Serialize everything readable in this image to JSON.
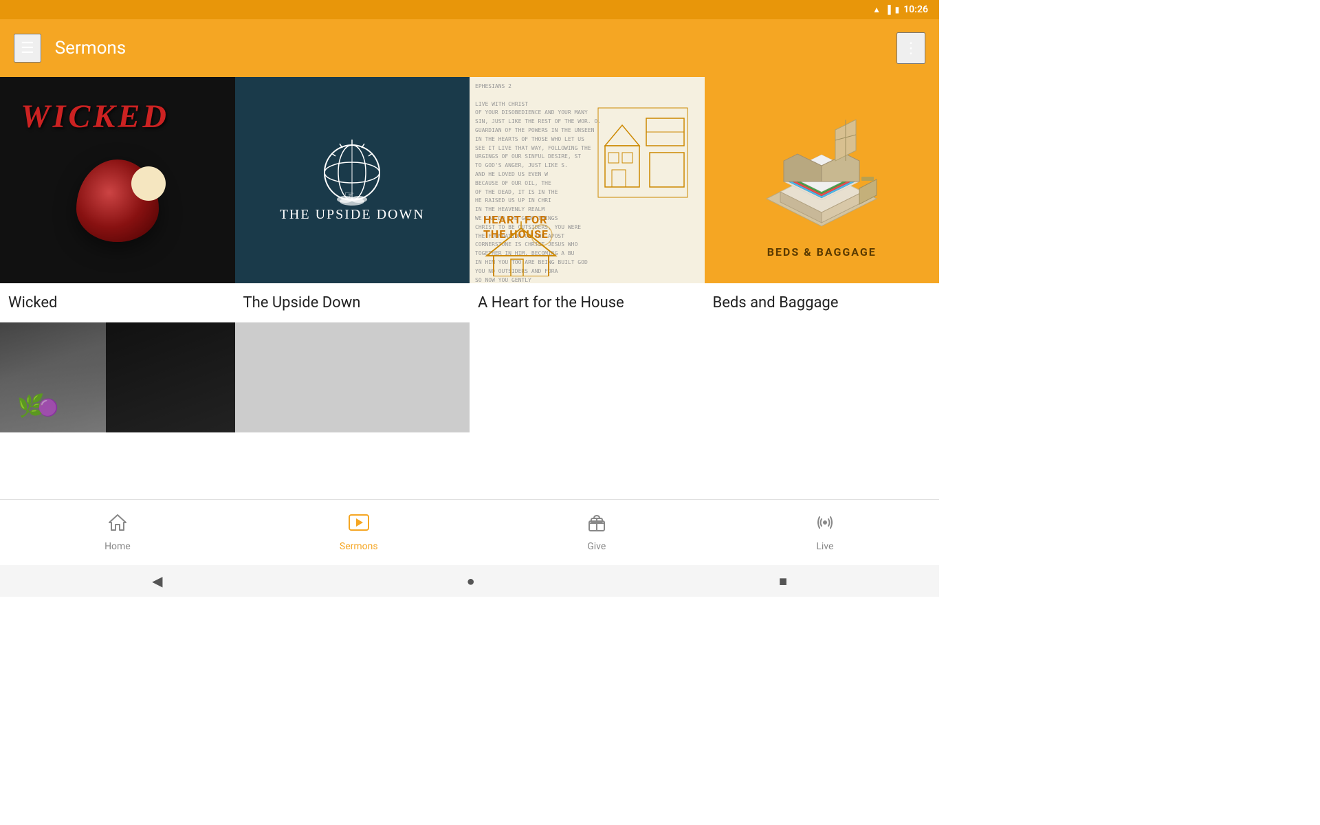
{
  "statusBar": {
    "time": "10:26",
    "wifiIcon": "wifi",
    "signalIcon": "signal",
    "batteryIcon": "battery"
  },
  "appBar": {
    "title": "Sermons",
    "menuIcon": "☰",
    "moreIcon": "⋮"
  },
  "sermonCards": [
    {
      "id": "wicked",
      "title": "Wicked",
      "imageType": "wicked",
      "imageLabel": "WICKED"
    },
    {
      "id": "upside-down",
      "title": "The Upside Down",
      "imageType": "upside-down",
      "imageLabel": "THE UPSIDE DOWN"
    },
    {
      "id": "heart-house",
      "title": "A Heart for the House",
      "imageType": "heart-house",
      "imageLabel": "HEART FOR THE HOUSE"
    },
    {
      "id": "beds-baggage",
      "title": "Beds and Baggage",
      "imageType": "beds-baggage",
      "imageLabel": "BEDS & BAGGAGE"
    }
  ],
  "secondRowCards": [
    {
      "id": "dark-landscape",
      "imageType": "dark-landscape"
    },
    {
      "id": "gray-placeholder",
      "imageType": "gray"
    },
    {
      "id": "empty1",
      "imageType": "empty"
    },
    {
      "id": "empty2",
      "imageType": "empty"
    }
  ],
  "bottomNav": {
    "items": [
      {
        "id": "home",
        "label": "Home",
        "icon": "⌂",
        "active": false
      },
      {
        "id": "sermons",
        "label": "Sermons",
        "icon": "▶",
        "active": true
      },
      {
        "id": "give",
        "label": "Give",
        "icon": "🎁",
        "active": false
      },
      {
        "id": "live",
        "label": "Live",
        "icon": "📡",
        "active": false
      }
    ]
  },
  "systemNav": {
    "back": "◀",
    "home": "●",
    "recent": "■"
  }
}
